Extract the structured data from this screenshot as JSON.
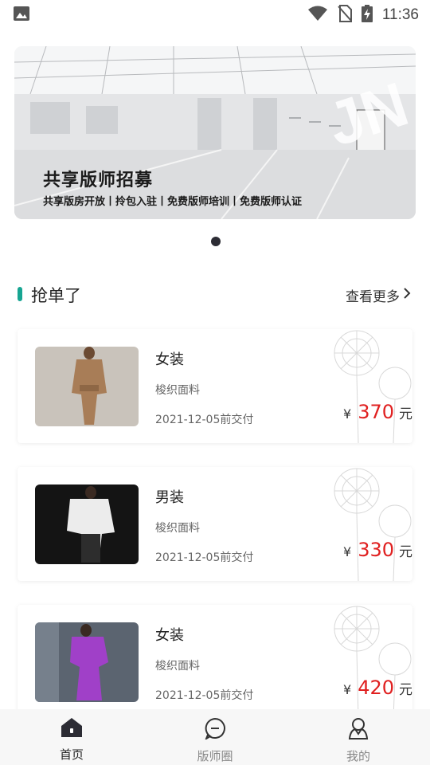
{
  "status_bar": {
    "time": "11:36"
  },
  "banner": {
    "title": "共享版师招募",
    "subtitle": "共享版房开放丨拎包入驻丨免费版师培训丨免费版师认证",
    "watermark": "JN"
  },
  "section": {
    "title": "抢单了",
    "see_more": "查看更多"
  },
  "orders": [
    {
      "category": "女装",
      "fabric": "梭织面料",
      "deadline": "2021-12-05前交付",
      "currency": "¥",
      "price": "370",
      "unit": "元"
    },
    {
      "category": "男装",
      "fabric": "梭织面料",
      "deadline": "2021-12-05前交付",
      "currency": "¥",
      "price": "330",
      "unit": "元"
    },
    {
      "category": "女装",
      "fabric": "梭织面料",
      "deadline": "2021-12-05前交付",
      "currency": "¥",
      "price": "420",
      "unit": "元"
    }
  ],
  "nav": {
    "items": [
      {
        "label": "首页",
        "icon": "home-icon",
        "active": true
      },
      {
        "label": "版师圈",
        "icon": "chat-icon",
        "active": false
      },
      {
        "label": "我的",
        "icon": "profile-icon",
        "active": false
      }
    ]
  },
  "colors": {
    "accent": "#17a592",
    "price": "#e02020"
  }
}
